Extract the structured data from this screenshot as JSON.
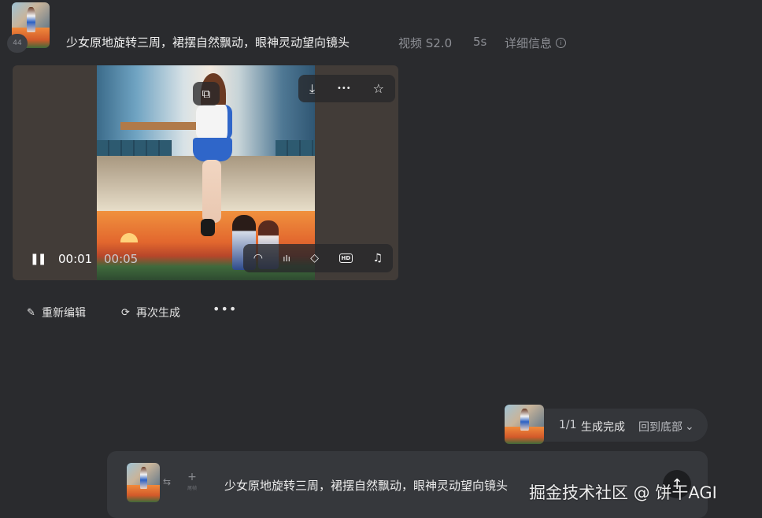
{
  "header": {
    "badge": "44",
    "prompt": "少女原地旋转三周，裙摆自然飘动，眼神灵动望向镜头",
    "model": "视频 S2.0",
    "duration": "5s",
    "details_label": "详细信息",
    "info_icon": "i"
  },
  "player": {
    "current_time": "00:01",
    "total_time": "00:05",
    "pause_icon": "❚❚",
    "restore_icon": "⧉",
    "download_icon": "⤓",
    "more_icon": "•••",
    "favorite_icon": "☆",
    "lip_icon": "◠",
    "audio_icon": "ıIı",
    "frame_icon": "◇",
    "hd_label": "HD",
    "music_icon": "♫"
  },
  "actions": {
    "edit_label": "重新编辑",
    "regenerate_label": "再次生成",
    "more_label": "•••",
    "edit_icon": "✎",
    "regen_icon": "⟳"
  },
  "status": {
    "count": "1/1",
    "state": "生成完成",
    "back_label": "回到底部",
    "back_icon": "⌄"
  },
  "input": {
    "swap_icon": "⇆",
    "add_icon": "+",
    "add_label": "尾帧",
    "text": "少女原地旋转三周，裙摆自然飘动，眼神灵动望向镜头",
    "send_icon": "↑"
  },
  "watermark": "掘金技术社区 @ 饼干AGI"
}
